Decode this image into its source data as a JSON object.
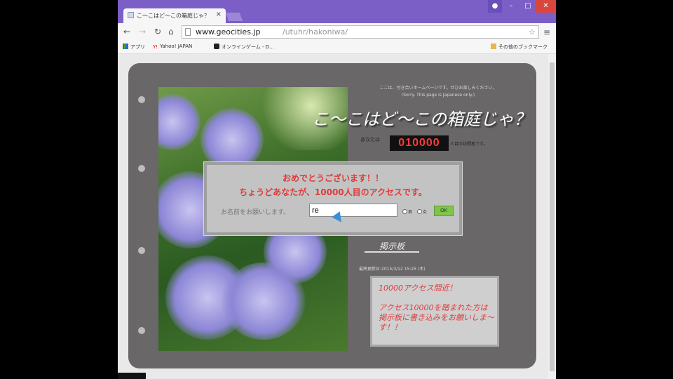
{
  "browser": {
    "tab_title": "こ～こはど～この箱庭じゃ？",
    "tab_close": "×",
    "controls": {
      "minimize": "–",
      "maximize": "□",
      "close": "✕"
    },
    "url_host": "www.geocities.jp",
    "url_path": "/utuhr/hakoniwa/",
    "bookmarks": [
      {
        "label": "アプリ",
        "icon": "apps-icon"
      },
      {
        "label": "Yahoo! JAPAN",
        "icon": "yahoo-icon"
      },
      {
        "label": "オンラインゲーム - D...",
        "icon": "d-icon"
      }
    ],
    "other_bookmarks": "その他のブックマーク"
  },
  "page": {
    "intro_line1": "ここは、付き合いホームページです。ぜひお楽しみください。",
    "intro_line2": "(Sorry. This page is Japanese only.)",
    "site_title": "こ～こはど～この箱庭じゃ？",
    "counter_prefix": "あなたは",
    "counter_value": "010000",
    "counter_suffix": "人目の訪問者です。",
    "bbs_link": "掲示板",
    "last_updated": "最終更新日:2015/3/12 15:25  (木)",
    "notice_title": "10000アクセス間近！",
    "notice_body": "アクセス10000を踏まれた方は掲示板に書き込みをお願いしま～す！！"
  },
  "dialog": {
    "line1": "おめでとうございます！！",
    "line2": "ちょうどあなたが、10000人目のアクセスです。",
    "name_label": "お名前をお願いします。",
    "name_value": "re",
    "radio_male": "男",
    "radio_female": "女",
    "ok_label": "OK"
  }
}
